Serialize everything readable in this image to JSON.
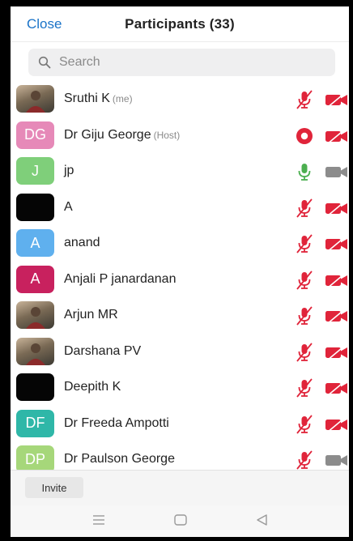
{
  "header": {
    "close_label": "Close",
    "title": "Participants (33)"
  },
  "search": {
    "placeholder": "Search"
  },
  "participants": [
    {
      "name": "Sruthi K",
      "tag": "(me)",
      "avatar": "photo",
      "mic": "muted",
      "cam": "off"
    },
    {
      "name": "Dr Giju George",
      "tag": "(Host)",
      "initials": "DG",
      "avatar_color": "#e689b8",
      "mic": "recording",
      "cam": "off"
    },
    {
      "name": "jp",
      "tag": "",
      "initials": "J",
      "avatar_color": "#7fcf7a",
      "mic": "active",
      "cam": "idle"
    },
    {
      "name": "A",
      "tag": "",
      "avatar": "black",
      "mic": "muted",
      "cam": "off"
    },
    {
      "name": "anand",
      "tag": "",
      "initials": "A",
      "avatar_color": "#5fb0ee",
      "mic": "muted",
      "cam": "off"
    },
    {
      "name": "Anjali P janardanan",
      "tag": "",
      "initials": "A",
      "avatar_color": "#c8215e",
      "mic": "muted",
      "cam": "off"
    },
    {
      "name": "Arjun MR",
      "tag": "",
      "avatar": "photo",
      "mic": "muted",
      "cam": "off"
    },
    {
      "name": "Darshana PV",
      "tag": "",
      "avatar": "photo",
      "mic": "muted",
      "cam": "off"
    },
    {
      "name": "Deepith K",
      "tag": "",
      "avatar": "black",
      "mic": "muted",
      "cam": "off"
    },
    {
      "name": "Dr Freeda Ampotti",
      "tag": "",
      "initials": "DF",
      "avatar_color": "#2fb7a8",
      "mic": "muted",
      "cam": "off"
    },
    {
      "name": "Dr Paulson George",
      "tag": "",
      "initials": "DP",
      "avatar_color": "#a6d77a",
      "mic": "muted",
      "cam": "idle"
    }
  ],
  "footer": {
    "invite_label": "Invite"
  },
  "colors": {
    "accent": "#1a73c8",
    "muted_red": "#e0243a",
    "active_green": "#4caf50",
    "idle_gray": "#8c8c8c"
  }
}
